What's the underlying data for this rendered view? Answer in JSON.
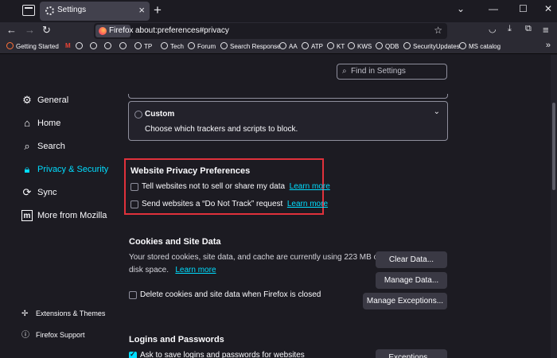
{
  "tab": {
    "title": "Settings"
  },
  "window_controls": [
    "⌄",
    "—",
    "☐",
    "✕"
  ],
  "nav": {
    "identity": "Firefox",
    "url": "about:preferences#privacy"
  },
  "bookmarks": [
    "Getting Started",
    "M",
    "",
    "",
    "",
    "TP",
    "Tech",
    "Forum",
    "Search Response",
    "AA",
    "ATP",
    "KT",
    "KWS",
    "QDB",
    "SecurityUpdates",
    "MS catalog"
  ],
  "search": {
    "placeholder": "Find in Settings"
  },
  "sidebar": {
    "items": [
      {
        "label": "General",
        "icon": "gear-icon"
      },
      {
        "label": "Home",
        "icon": "home-icon"
      },
      {
        "label": "Search",
        "icon": "search-icon"
      },
      {
        "label": "Privacy & Security",
        "icon": "lock-icon",
        "active": true
      },
      {
        "label": "Sync",
        "icon": "sync-icon"
      },
      {
        "label": "More from Mozilla",
        "icon": "mozilla-icon"
      }
    ],
    "footer": [
      {
        "label": "Extensions & Themes",
        "icon": "puzzle-icon"
      },
      {
        "label": "Firefox Support",
        "icon": "help-icon"
      }
    ]
  },
  "custom": {
    "title": "Custom",
    "description": "Choose which trackers and scripts to block."
  },
  "privacy_prefs": {
    "title": "Website Privacy Preferences",
    "options": [
      {
        "label": "Tell websites not to sell or share my data",
        "link": "Learn more",
        "checked": false
      },
      {
        "label": "Send websites a “Do Not Track” request",
        "link": "Learn more",
        "checked": false
      }
    ]
  },
  "cookies": {
    "title": "Cookies and Site Data",
    "desc_line1": "Your stored cookies, site data, and cache are currently using 223 MB of",
    "desc_line2": "disk space.",
    "learn_more": "Learn more",
    "clear_button": "Clear Data...",
    "manage_button": "Manage Data...",
    "exceptions_button": "Manage Exceptions...",
    "delete_option": "Delete cookies and site data when Firefox is closed"
  },
  "logins": {
    "title": "Logins and Passwords",
    "ask_option": "Ask to save logins and passwords for websites",
    "exceptions_button": "Exceptions..."
  },
  "colors": {
    "accent": "#00ddff",
    "highlight": "#e0313b",
    "bg": "#1c1b22"
  }
}
